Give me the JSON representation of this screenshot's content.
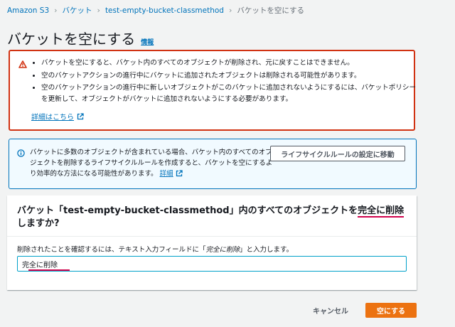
{
  "breadcrumb": {
    "items": [
      "Amazon S3",
      "バケット",
      "test-empty-bucket-classmethod"
    ],
    "current": "バケットを空にする"
  },
  "page": {
    "title": "バケットを空にする",
    "info_label": "情報"
  },
  "warning": {
    "icon": "warning-icon",
    "bullets": [
      "バケットを空にすると、バケット内のすべてのオブジェクトが削除され、元に戻すことはできません。",
      "空のバケットアクションの進行中にバケットに追加されたオブジェクトは削除される可能性があります。",
      "空のバケットアクションの進行中に新しいオブジェクトがこのバケットに追加されないようにするには、バケットポリシーを更新して、オブジェクトがバケットに追加されないようにする必要があります。"
    ],
    "more_link": "詳細はこちら"
  },
  "info_box": {
    "icon": "info-icon",
    "text": "バケットに多数のオブジェクトが含まれている場合、バケット内のすべてのオブジェクトを削除するライフサイクルルールを作成すると、バケットを空にするより効率的な方法になる可能性があります。",
    "link": "詳細",
    "button": "ライフサイクルルールの設定に移動"
  },
  "confirm": {
    "question_prefix": "バケット「test-empty-bucket-classmethod」内のすべてのオブジェクトを",
    "question_highlight": "完全に削除",
    "question_suffix": "しますか?",
    "label_before": "削除されたことを確認するには、テキスト入力フィールドに「",
    "label_em": "完全に削除",
    "label_after": "」と入力します。",
    "input_value": "完全に削除"
  },
  "actions": {
    "cancel": "キャンセル",
    "submit": "空にする"
  },
  "colors": {
    "link": "#0073bb",
    "error_border": "#d13212",
    "info_border": "#0073bb",
    "primary": "#ec7211",
    "annotation": "#d0024c"
  }
}
